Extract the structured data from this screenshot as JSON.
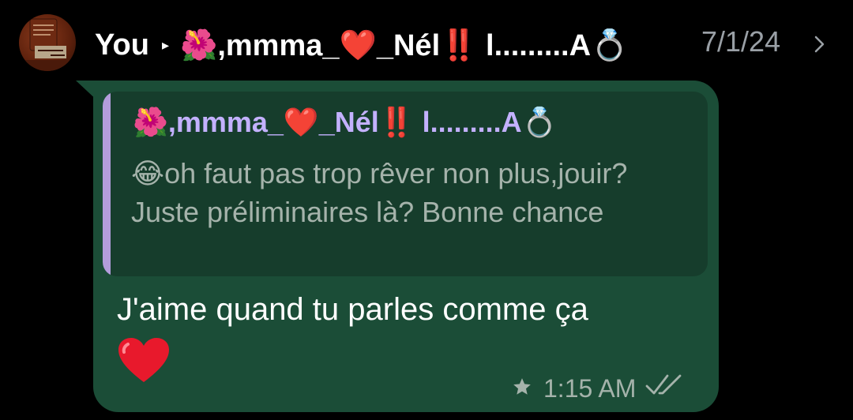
{
  "header": {
    "sender": "You",
    "arrow_glyph": "▸",
    "recipient_prefix": "🌺",
    "recipient_name_a": ",mmma_",
    "recipient_heart": "❤️",
    "recipient_name_b": "_Nél",
    "recipient_bang": "‼️",
    "recipient_name_c": " l.........A",
    "recipient_ring": "💍",
    "date": "7/1/24"
  },
  "quote": {
    "name_prefix": "🌺",
    "name_a": ",mmma_",
    "name_heart": "❤️",
    "name_b": "_Nél",
    "name_bang": "‼️",
    "name_c": " l.........A",
    "name_ring": "💍",
    "emoji": "😂",
    "text": "oh faut pas trop rêver non plus,jouir? Juste préliminaires là? Bonne chance"
  },
  "message": {
    "text": "J'aime quand tu parles comme ça",
    "emoji": "❤️",
    "time": "1:15 AM",
    "starred": true,
    "read_status": "read"
  },
  "colors": {
    "background": "#000000",
    "bubble": "#1b4d37",
    "quote_bg": "#163d2c",
    "quote_bar": "#b39ddb",
    "quote_name": "#c3b1ff",
    "meta_text": "#a5b3ab"
  },
  "icons": {
    "avatar": "profile-picture",
    "forward": "chevron-right-icon",
    "star": "star-icon",
    "read": "double-check-icon"
  }
}
